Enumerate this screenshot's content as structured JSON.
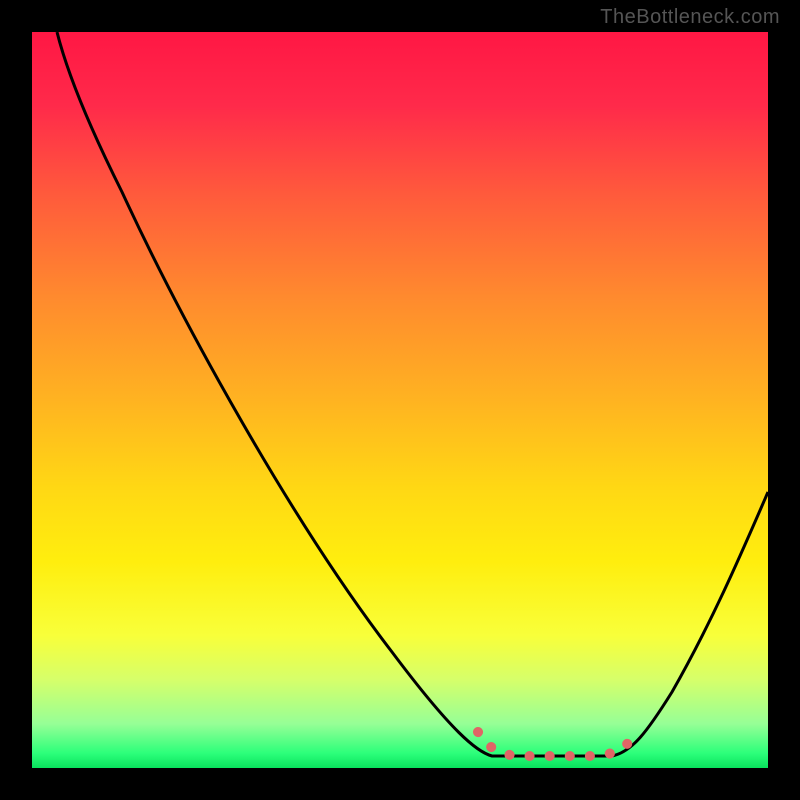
{
  "watermark": "TheBottleneck.com",
  "chart_data": {
    "type": "line",
    "title": "",
    "xlabel": "",
    "ylabel": "",
    "xlim": [
      0,
      100
    ],
    "ylim": [
      0,
      100
    ],
    "x": [
      3,
      6,
      12,
      20,
      35,
      49,
      60,
      63,
      72,
      79,
      82,
      87,
      92,
      97,
      100
    ],
    "values": [
      100,
      95,
      78,
      60,
      33,
      15,
      3,
      1.5,
      1.5,
      1.5,
      3,
      10,
      20,
      30,
      37
    ],
    "annotations": [
      {
        "type": "dotted-segment",
        "x_from": 60,
        "x_to": 82,
        "y": 2,
        "color": "#e06666",
        "meaning": "optimal range"
      }
    ],
    "background_gradient_stops": [
      {
        "pos": 0.0,
        "color": "#ff1744"
      },
      {
        "pos": 0.5,
        "color": "#ffb321"
      },
      {
        "pos": 0.82,
        "color": "#f8ff3a"
      },
      {
        "pos": 1.0,
        "color": "#09e25d"
      }
    ]
  }
}
